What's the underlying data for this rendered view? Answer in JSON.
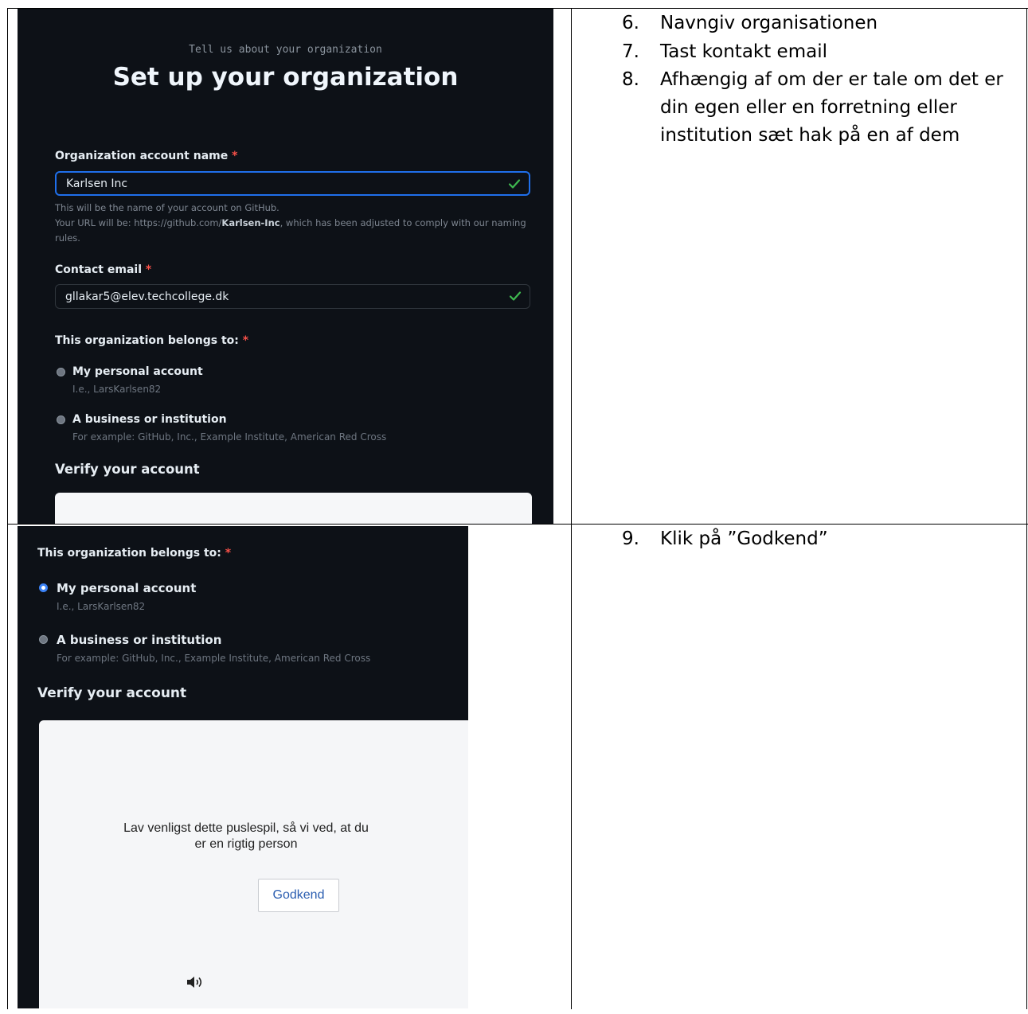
{
  "setup": {
    "subtitle": "Tell us about your organization",
    "title": "Set up your organization",
    "name_label": "Organization account name",
    "required_mark": "*",
    "name_value": "Karlsen Inc",
    "name_help_1": "This will be the name of your account on GitHub.",
    "name_help_2_prefix": "Your URL will be: https://github.com/",
    "name_help_2_slug": "Karlsen-Inc",
    "name_help_2_suffix": ", which has been adjusted to comply with our naming",
    "name_help_3": "rules.",
    "email_label": "Contact email",
    "email_value": "gllakar5@elev.techcollege.dk",
    "belongs_label": "This organization belongs to:",
    "option_personal": "My personal account",
    "option_personal_sub": "I.e., LarsKarlsen82",
    "option_business": "A business or institution",
    "option_business_sub": "For example: GitHub, Inc., Example Institute, American Red Cross",
    "verify_heading": "Verify your account"
  },
  "puzzle": {
    "text_line1": "Lav venligst dette puslespil, så vi ved, at du",
    "text_line2": "er en rigtig person",
    "button_label": "Godkend",
    "audio_icon": "speaker-icon"
  },
  "instructions": {
    "step6_num": "6.",
    "step6_text": "Navngiv organisationen",
    "step7_num": "7.",
    "step7_text": "Tast kontakt email",
    "step8_num": "8.",
    "step8_text": "Afhængig af om der er tale om det er din egen eller en forretning eller institution sæt hak på en af dem",
    "step9_num": "9.",
    "step9_text": "Klik på ”Godkend”"
  },
  "colors": {
    "github_dark_bg": "#0d1117",
    "focus_blue": "#1f6feb",
    "valid_green": "#3fb950",
    "required_red": "#f85149"
  }
}
